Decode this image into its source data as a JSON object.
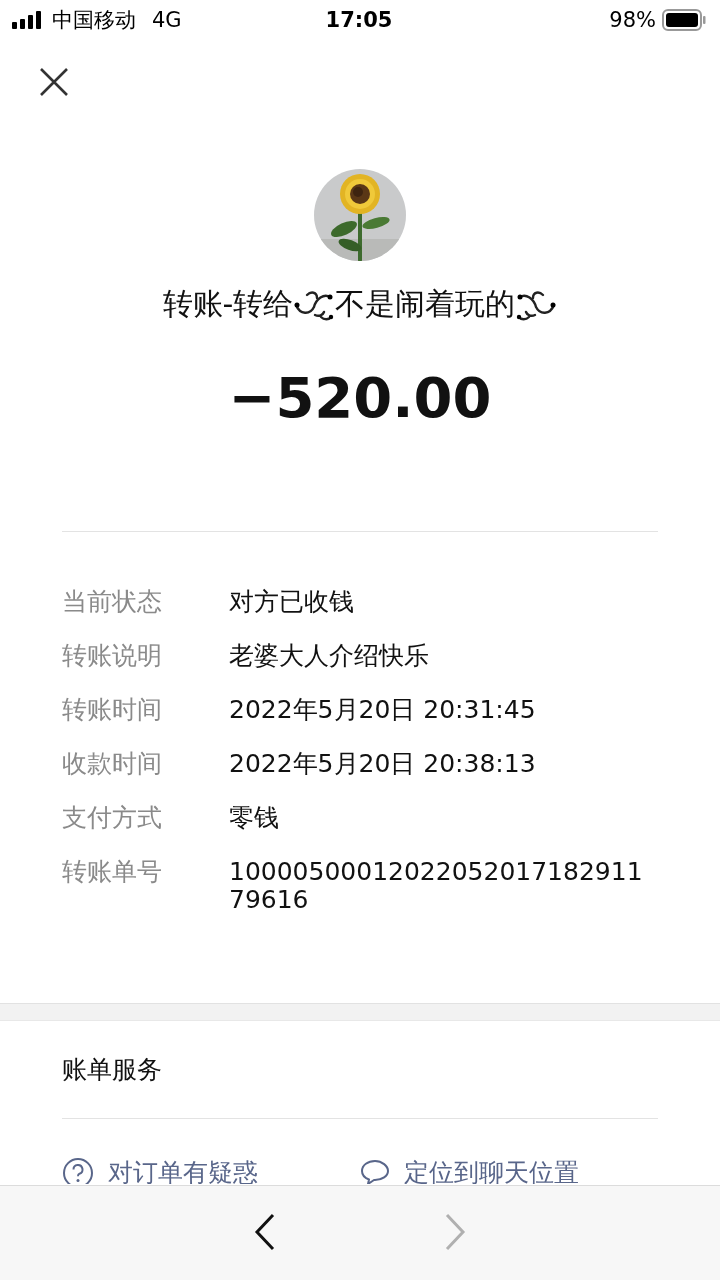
{
  "status_bar": {
    "carrier": "中国移动",
    "network": "4G",
    "time": "17:05",
    "battery": "98%"
  },
  "transfer": {
    "prefix": "转账-转给",
    "recipient": "不是闹着玩的",
    "amount": "−520.00"
  },
  "details": [
    {
      "label": "当前状态",
      "value": "对方已收钱"
    },
    {
      "label": "转账说明",
      "value": "老婆大人介绍快乐"
    },
    {
      "label": "转账时间",
      "value": "2022年5月20日 20:31:45"
    },
    {
      "label": "收款时间",
      "value": "2022年5月20日 20:38:13"
    },
    {
      "label": "支付方式",
      "value": "零钱"
    },
    {
      "label": "转账单号",
      "value": "1000050001202205201718291179616"
    }
  ],
  "bill_service": {
    "title": "账单服务",
    "actions": [
      {
        "kind": "question",
        "label": "对订单有疑惑"
      },
      {
        "kind": "chat",
        "label": "定位到聊天位置"
      }
    ]
  },
  "toolbar": {
    "back_disabled": false,
    "forward_disabled": true
  }
}
